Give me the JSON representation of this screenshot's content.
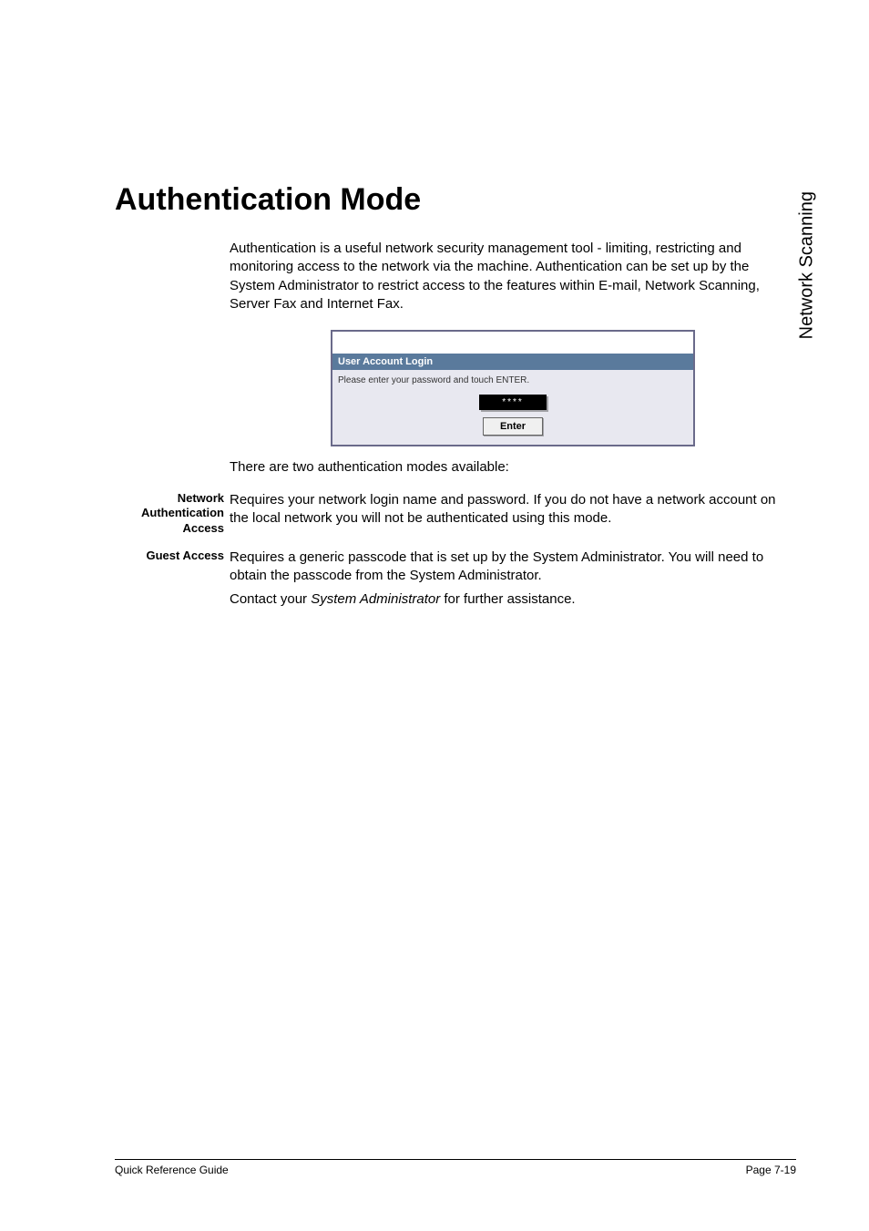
{
  "side_label": "Network Scanning",
  "title": "Authentication Mode",
  "intro": "Authentication is a useful network security management tool - limiting, restricting and monitoring access to the network via the machine. Authentication can be set up by the System Administrator to restrict access to the features within E-mail, Network Scanning, Server Fax and Internet Fax.",
  "screenshot": {
    "bar_title": "User Account Login",
    "hint": "Please enter your password and touch ENTER.",
    "password_mask": "****",
    "enter_label": "Enter"
  },
  "subtext": "There are two authentication modes available:",
  "entries": {
    "naa": {
      "label_line1": "Network",
      "label_line2": "Authentication",
      "label_line3": "Access",
      "body": "Requires your network login name and password. If you do not have a network account on the local network you will not be authenticated using this mode."
    },
    "guest": {
      "label": "Guest Access",
      "body1": "Requires a generic passcode that is set up by the System Administrator. You will need to obtain the passcode from the System Administrator.",
      "body2_pre": "Contact your ",
      "body2_em": "System Administrator",
      "body2_post": " for further assistance."
    }
  },
  "footer": {
    "left": "Quick Reference Guide",
    "right": "Page 7-19"
  }
}
